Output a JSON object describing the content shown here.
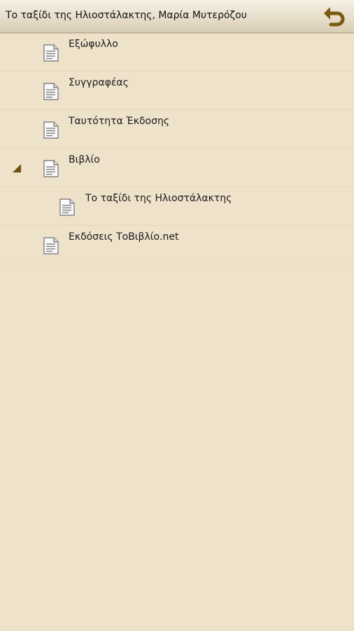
{
  "header": {
    "title": "Το ταξίδι της Ηλιοστάλακτης, Μαρία Μυτερόζου",
    "back_icon": "back-arrow-icon",
    "accent_color": "#7a5a10"
  },
  "toc": {
    "items": [
      {
        "label": "Εξώφυλλο"
      },
      {
        "label": "Συγγραφέας"
      },
      {
        "label": "Ταυτότητα Έκδοσης"
      },
      {
        "label": "Βιβλίο",
        "expanded": true
      },
      {
        "label": "Το ταξίδι της Ηλιοστάλακτης"
      },
      {
        "label": "Εκδόσεις ΤοΒιβλίο.net"
      }
    ]
  }
}
